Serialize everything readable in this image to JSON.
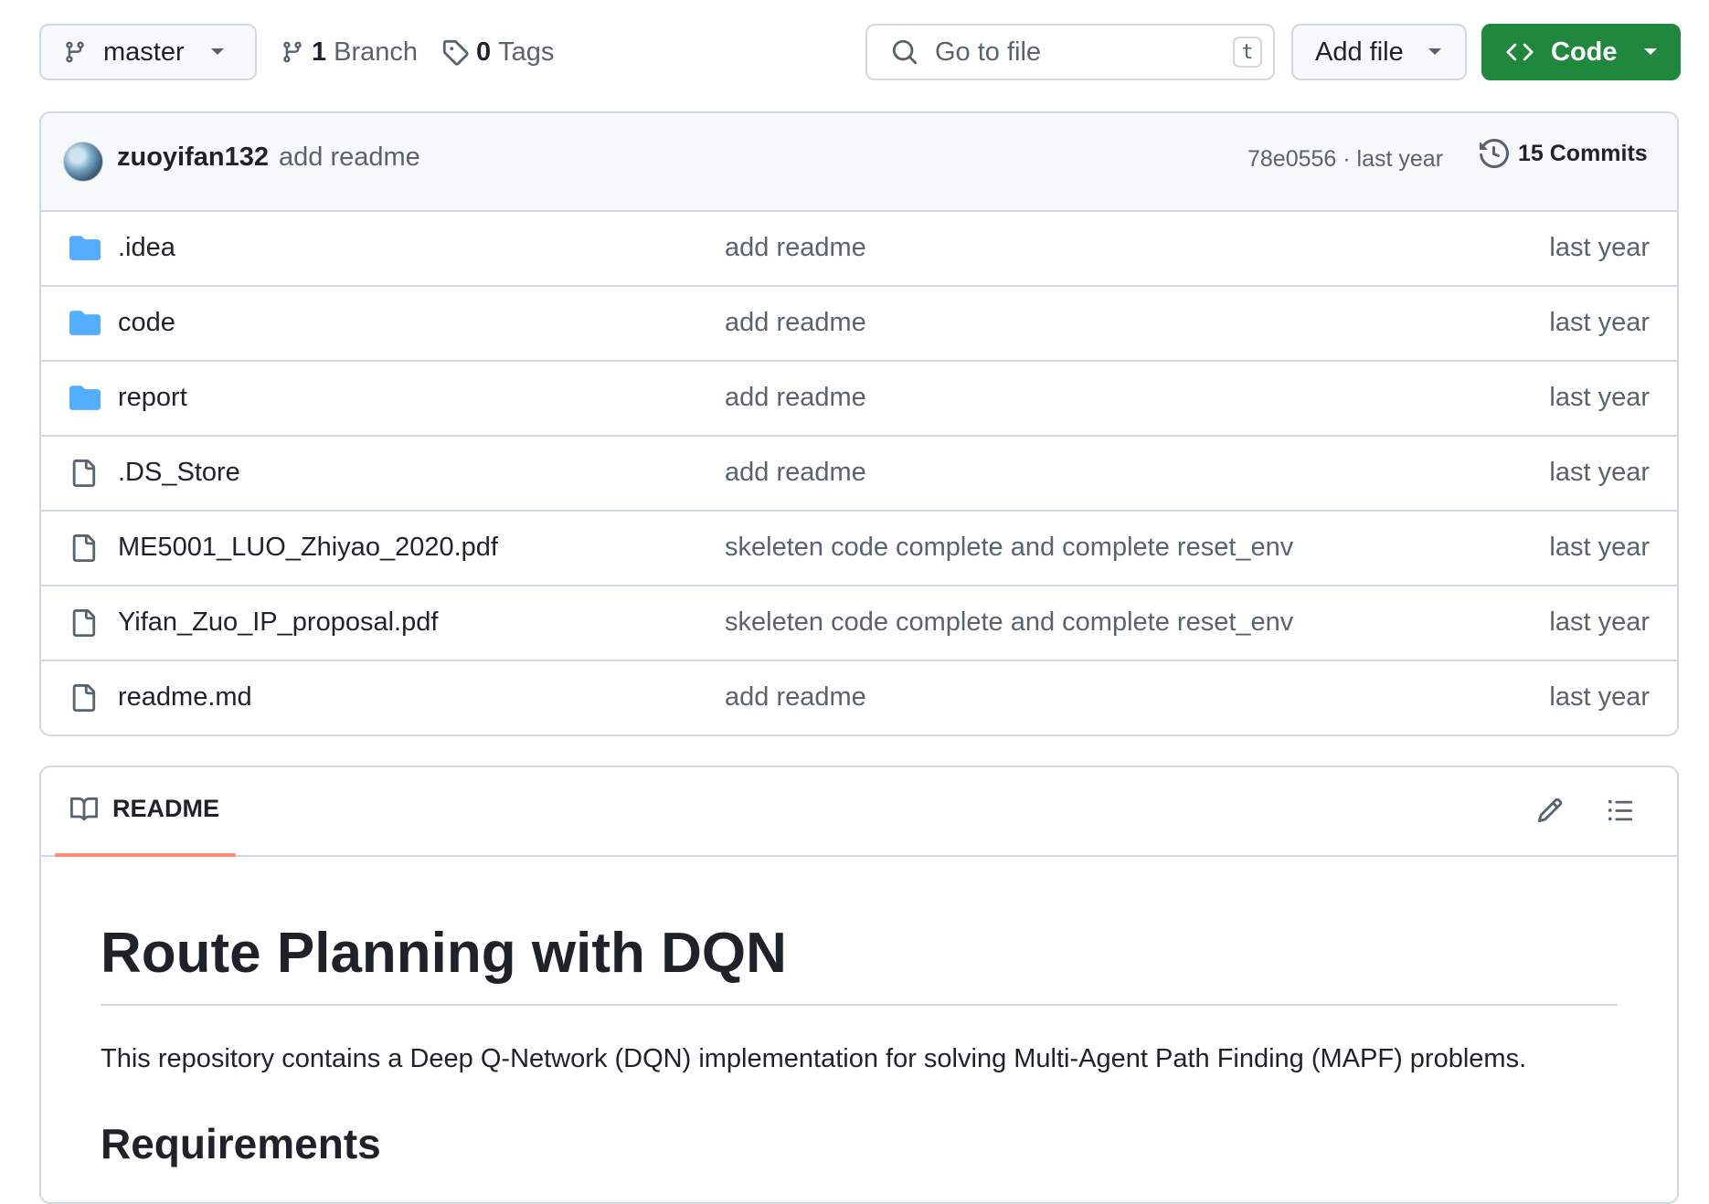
{
  "toolbar": {
    "branch": "master",
    "branch_count": "1",
    "branch_label": "Branch",
    "tag_count": "0",
    "tag_label": "Tags",
    "goto_placeholder": "Go to file",
    "goto_shortcut": "t",
    "add_file_label": "Add file",
    "code_label": "Code"
  },
  "latest_commit": {
    "author": "zuoyifan132",
    "message": "add readme",
    "hash_time": "78e0556 · last year",
    "commits_label": "15 Commits"
  },
  "files": [
    {
      "name": ".idea",
      "type": "folder",
      "message": "add readme",
      "date": "last year"
    },
    {
      "name": "code",
      "type": "folder",
      "message": "add readme",
      "date": "last year"
    },
    {
      "name": "report",
      "type": "folder",
      "message": "add readme",
      "date": "last year"
    },
    {
      "name": ".DS_Store",
      "type": "file",
      "message": "add readme",
      "date": "last year"
    },
    {
      "name": "ME5001_LUO_Zhiyao_2020.pdf",
      "type": "file",
      "message": "skeleten code complete and complete reset_env",
      "date": "last year"
    },
    {
      "name": "Yifan_Zuo_IP_proposal.pdf",
      "type": "file",
      "message": "skeleten code complete and complete reset_env",
      "date": "last year"
    },
    {
      "name": "readme.md",
      "type": "file",
      "message": "add readme",
      "date": "last year"
    }
  ],
  "readme": {
    "tab_label": "README",
    "title": "Route Planning with DQN",
    "paragraph": "This repository contains a Deep Q-Network (DQN) implementation for solving Multi-Agent Path Finding (MAPF) problems.",
    "next_heading": "Requirements"
  },
  "colors": {
    "code_button": "#1f883d",
    "folder_icon": "#54aeff",
    "tab_underline": "#fd8c73"
  }
}
